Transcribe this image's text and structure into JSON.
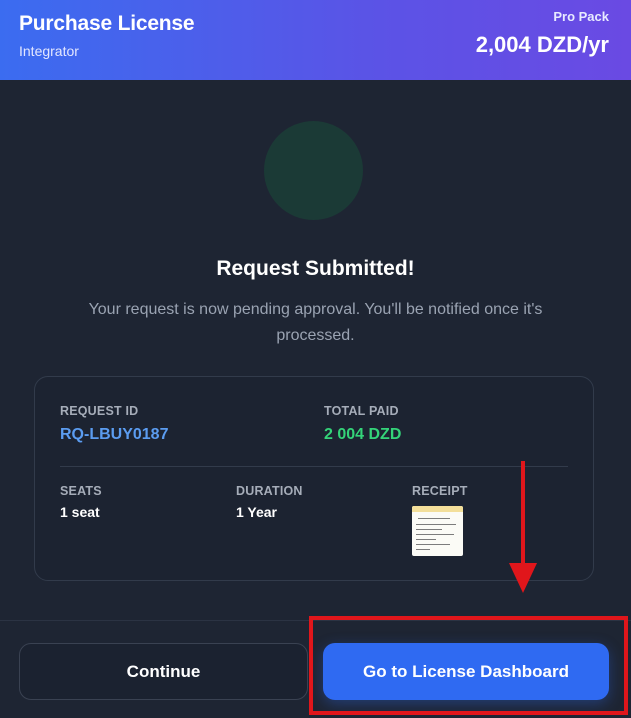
{
  "header": {
    "title": "Purchase License",
    "subtitle": "Integrator",
    "plan_name": "Pro Pack",
    "plan_price": "2,004 DZD/yr"
  },
  "status": {
    "heading": "Request Submitted!",
    "message": "Your request is now pending approval. You'll be notified once it's processed."
  },
  "details": {
    "request_id_label": "REQUEST ID",
    "request_id_value": "RQ-LBUY0187",
    "total_paid_label": "TOTAL PAID",
    "total_paid_value": "2 004 DZD",
    "seats_label": "SEATS",
    "seats_value": "1 seat",
    "duration_label": "DURATION",
    "duration_value": "1 Year",
    "receipt_label": "RECEIPT"
  },
  "footer": {
    "continue_label": "Continue",
    "dashboard_label": "Go to License Dashboard"
  },
  "colors": {
    "header_gradient_start": "#3b6cf0",
    "header_gradient_end": "#6a4ae3",
    "background": "#1e2533",
    "request_id": "#5b9cf0",
    "total_paid": "#34d379",
    "primary_button": "#2f6af2",
    "annotation": "#e0161b"
  },
  "annotation": {
    "type": "arrow-and-box",
    "target": "dashboard-button"
  }
}
